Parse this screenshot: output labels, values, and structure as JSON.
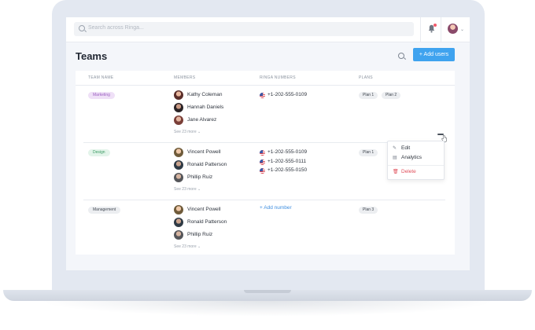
{
  "search": {
    "placeholder": "Search across Ringa..."
  },
  "page": {
    "title": "Teams",
    "add_users_label": "+ Add users"
  },
  "table": {
    "headers": [
      "TEAM NAME",
      "MEMBERS",
      "RINGA NUMBERS",
      "PLANS"
    ],
    "rows": [
      {
        "team": "Marketing",
        "members": [
          "Kathy Coleman",
          "Hannah Daniels",
          "Jane Alvarez"
        ],
        "see_more": "See 23 more ⌄",
        "numbers": [
          "+1-202-555-0109"
        ],
        "plans": [
          "Plan 1",
          "Plan 2"
        ]
      },
      {
        "team": "Design",
        "members": [
          "Vincent Powell",
          "Ronald Patterson",
          "Phillip Ruiz"
        ],
        "see_more": "See 23 more ⌄",
        "numbers": [
          "+1-202-555-0109",
          "+1-202-555-0111",
          "+1-202-555-0150"
        ],
        "plans": [
          "Plan 1"
        ]
      },
      {
        "team": "Management",
        "members": [
          "Vincent Powell",
          "Ronald Patterson",
          "Phillip Ruiz"
        ],
        "see_more": "See 23 more ⌄",
        "add_number": "+ Add number",
        "plans": [
          "Plan 3"
        ]
      }
    ]
  },
  "menu": {
    "edit": "Edit",
    "analytics": "Analytics",
    "delete": "Delete"
  },
  "colors": {
    "accent": "#3fa3ef",
    "marketing_tag": "#efe0f7",
    "design_tag": "#e3f4ea",
    "delete": "#e0505c"
  }
}
